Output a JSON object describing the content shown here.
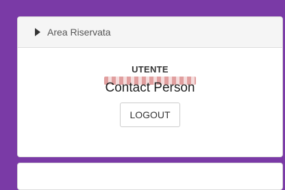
{
  "panel": {
    "title": "Area Riservata",
    "user_heading": "UTENTE",
    "user_name": "Contact Person",
    "logout_label": "LOGOUT"
  },
  "colors": {
    "background": "#7a3aa6",
    "panel_header": "#f5f5f5",
    "border": "#dcdcdc"
  },
  "icons": {
    "header": "caret-right-icon"
  }
}
